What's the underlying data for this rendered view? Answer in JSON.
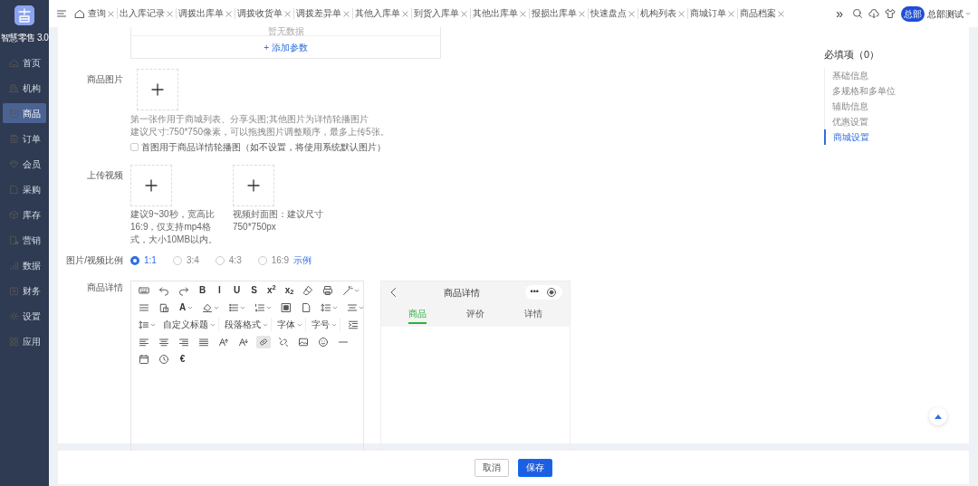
{
  "sidebar": {
    "brand": "智慧零售 3.0",
    "items": [
      {
        "label": "首页",
        "selected": false
      },
      {
        "label": "机构",
        "selected": false
      },
      {
        "label": "商品",
        "selected": true
      },
      {
        "label": "订单",
        "selected": false
      },
      {
        "label": "会员",
        "selected": false
      },
      {
        "label": "采购",
        "selected": false
      },
      {
        "label": "库存",
        "selected": false
      },
      {
        "label": "营销",
        "selected": false
      },
      {
        "label": "数据",
        "selected": false
      },
      {
        "label": "财务",
        "selected": false
      },
      {
        "label": "设置",
        "selected": false
      },
      {
        "label": "应用",
        "selected": false
      }
    ]
  },
  "topbar": {
    "tabs": [
      {
        "label": "查询"
      },
      {
        "label": "出入库记录"
      },
      {
        "label": "调拨出库单"
      },
      {
        "label": "调拨收货单"
      },
      {
        "label": "调拨差异单"
      },
      {
        "label": "其他入库单"
      },
      {
        "label": "到货入库单"
      },
      {
        "label": "其他出库单"
      },
      {
        "label": "报损出库单"
      },
      {
        "label": "快速盘点"
      },
      {
        "label": "机构列表"
      },
      {
        "label": "商城订单"
      },
      {
        "label": "商品档案"
      }
    ],
    "more": "»",
    "user": {
      "avatar": "总部",
      "name": "总部测试"
    }
  },
  "params_table": {
    "empty_text": "暂无数据",
    "add_link": "+ 添加参数"
  },
  "form": {
    "product_images": {
      "label": "商品图片",
      "hints": [
        "第一张作用于商城列表、分享头图;其他图片为详情轮播图片",
        "建议尺寸:750*750像素，可以拖拽图片调整顺序，最多上传5张。"
      ],
      "checkbox": {
        "label": "首图用于商品详情轮播图（如不设置，将使用系统默认图片）",
        "checked": false
      }
    },
    "video": {
      "label": "上传视频",
      "uploads": [
        {
          "hint": "建议9~30秒，宽高比16:9，仅支持mp4格式，大小10MB以内。"
        },
        {
          "hint": "视频封面图：建议尺寸750*750px"
        }
      ]
    },
    "ratio": {
      "label": "图片/视频比例",
      "options": [
        {
          "label": "1:1",
          "selected": true
        },
        {
          "label": "3:4",
          "selected": false
        },
        {
          "label": "4:3",
          "selected": false
        },
        {
          "label": "16:9",
          "selected": false
        }
      ],
      "example_link": "示例"
    },
    "detail": {
      "label": "商品详情",
      "toolbar": [
        [
          {
            "kind": "icon"
          },
          {
            "kind": "icon"
          },
          {
            "kind": "icon"
          },
          {
            "kind": "glyph",
            "text": "B"
          },
          {
            "kind": "glyph",
            "text": "I"
          },
          {
            "kind": "glyph",
            "text": "U"
          },
          {
            "kind": "glyph",
            "text": "S"
          },
          {
            "kind": "glyph",
            "text": "x$^{2}$"
          },
          {
            "kind": "glyph",
            "text": "x$_{2}$"
          },
          {
            "kind": "icon"
          },
          {
            "kind": "icon"
          },
          {
            "kind": "icon",
            "caret": true
          }
        ],
        [
          {
            "kind": "icon"
          },
          {
            "kind": "icon"
          },
          {
            "kind": "glyph",
            "text": "A",
            "caret": true
          },
          {
            "kind": "icon",
            "caret": true
          },
          {
            "kind": "icon",
            "caret": true
          },
          {
            "kind": "icon",
            "caret": true
          },
          {
            "kind": "icon"
          },
          {
            "kind": "icon"
          },
          {
            "kind": "icon",
            "caret": true
          },
          {
            "kind": "icon",
            "caret": true
          }
        ],
        [
          {
            "kind": "icon",
            "caret": true
          },
          {
            "kind": "select",
            "text": "自定义标题"
          },
          {
            "kind": "select",
            "text": "段落格式"
          },
          {
            "kind": "select",
            "text": "字体"
          },
          {
            "kind": "select",
            "text": "字号"
          },
          {
            "kind": "icon"
          }
        ],
        [
          {
            "kind": "icon"
          },
          {
            "kind": "icon"
          },
          {
            "kind": "icon"
          },
          {
            "kind": "icon"
          },
          {
            "kind": "icon"
          },
          {
            "kind": "icon"
          },
          {
            "kind": "icon",
            "active": true
          },
          {
            "kind": "icon"
          },
          {
            "kind": "icon"
          },
          {
            "kind": "icon"
          },
          {
            "kind": "icon"
          }
        ],
        [
          {
            "kind": "icon"
          },
          {
            "kind": "icon"
          },
          {
            "kind": "glyph",
            "text": "€"
          }
        ]
      ],
      "preview": {
        "title": "商品详情",
        "menu": "•••",
        "tabs": [
          {
            "label": "商品",
            "selected": true
          },
          {
            "label": "评价",
            "selected": false
          },
          {
            "label": "详情",
            "selected": false
          }
        ]
      }
    }
  },
  "anchor_nav": {
    "title": "必填项（0）",
    "items": [
      {
        "label": "基础信息",
        "selected": false
      },
      {
        "label": "多规格和多单位",
        "selected": false
      },
      {
        "label": "辅助信息",
        "selected": false
      },
      {
        "label": "优惠设置",
        "selected": false
      },
      {
        "label": "商城设置",
        "selected": true
      }
    ]
  },
  "footer": {
    "buttons": [
      {
        "label": "取消",
        "kind": "default"
      },
      {
        "label": "保存",
        "kind": "primary"
      }
    ]
  }
}
